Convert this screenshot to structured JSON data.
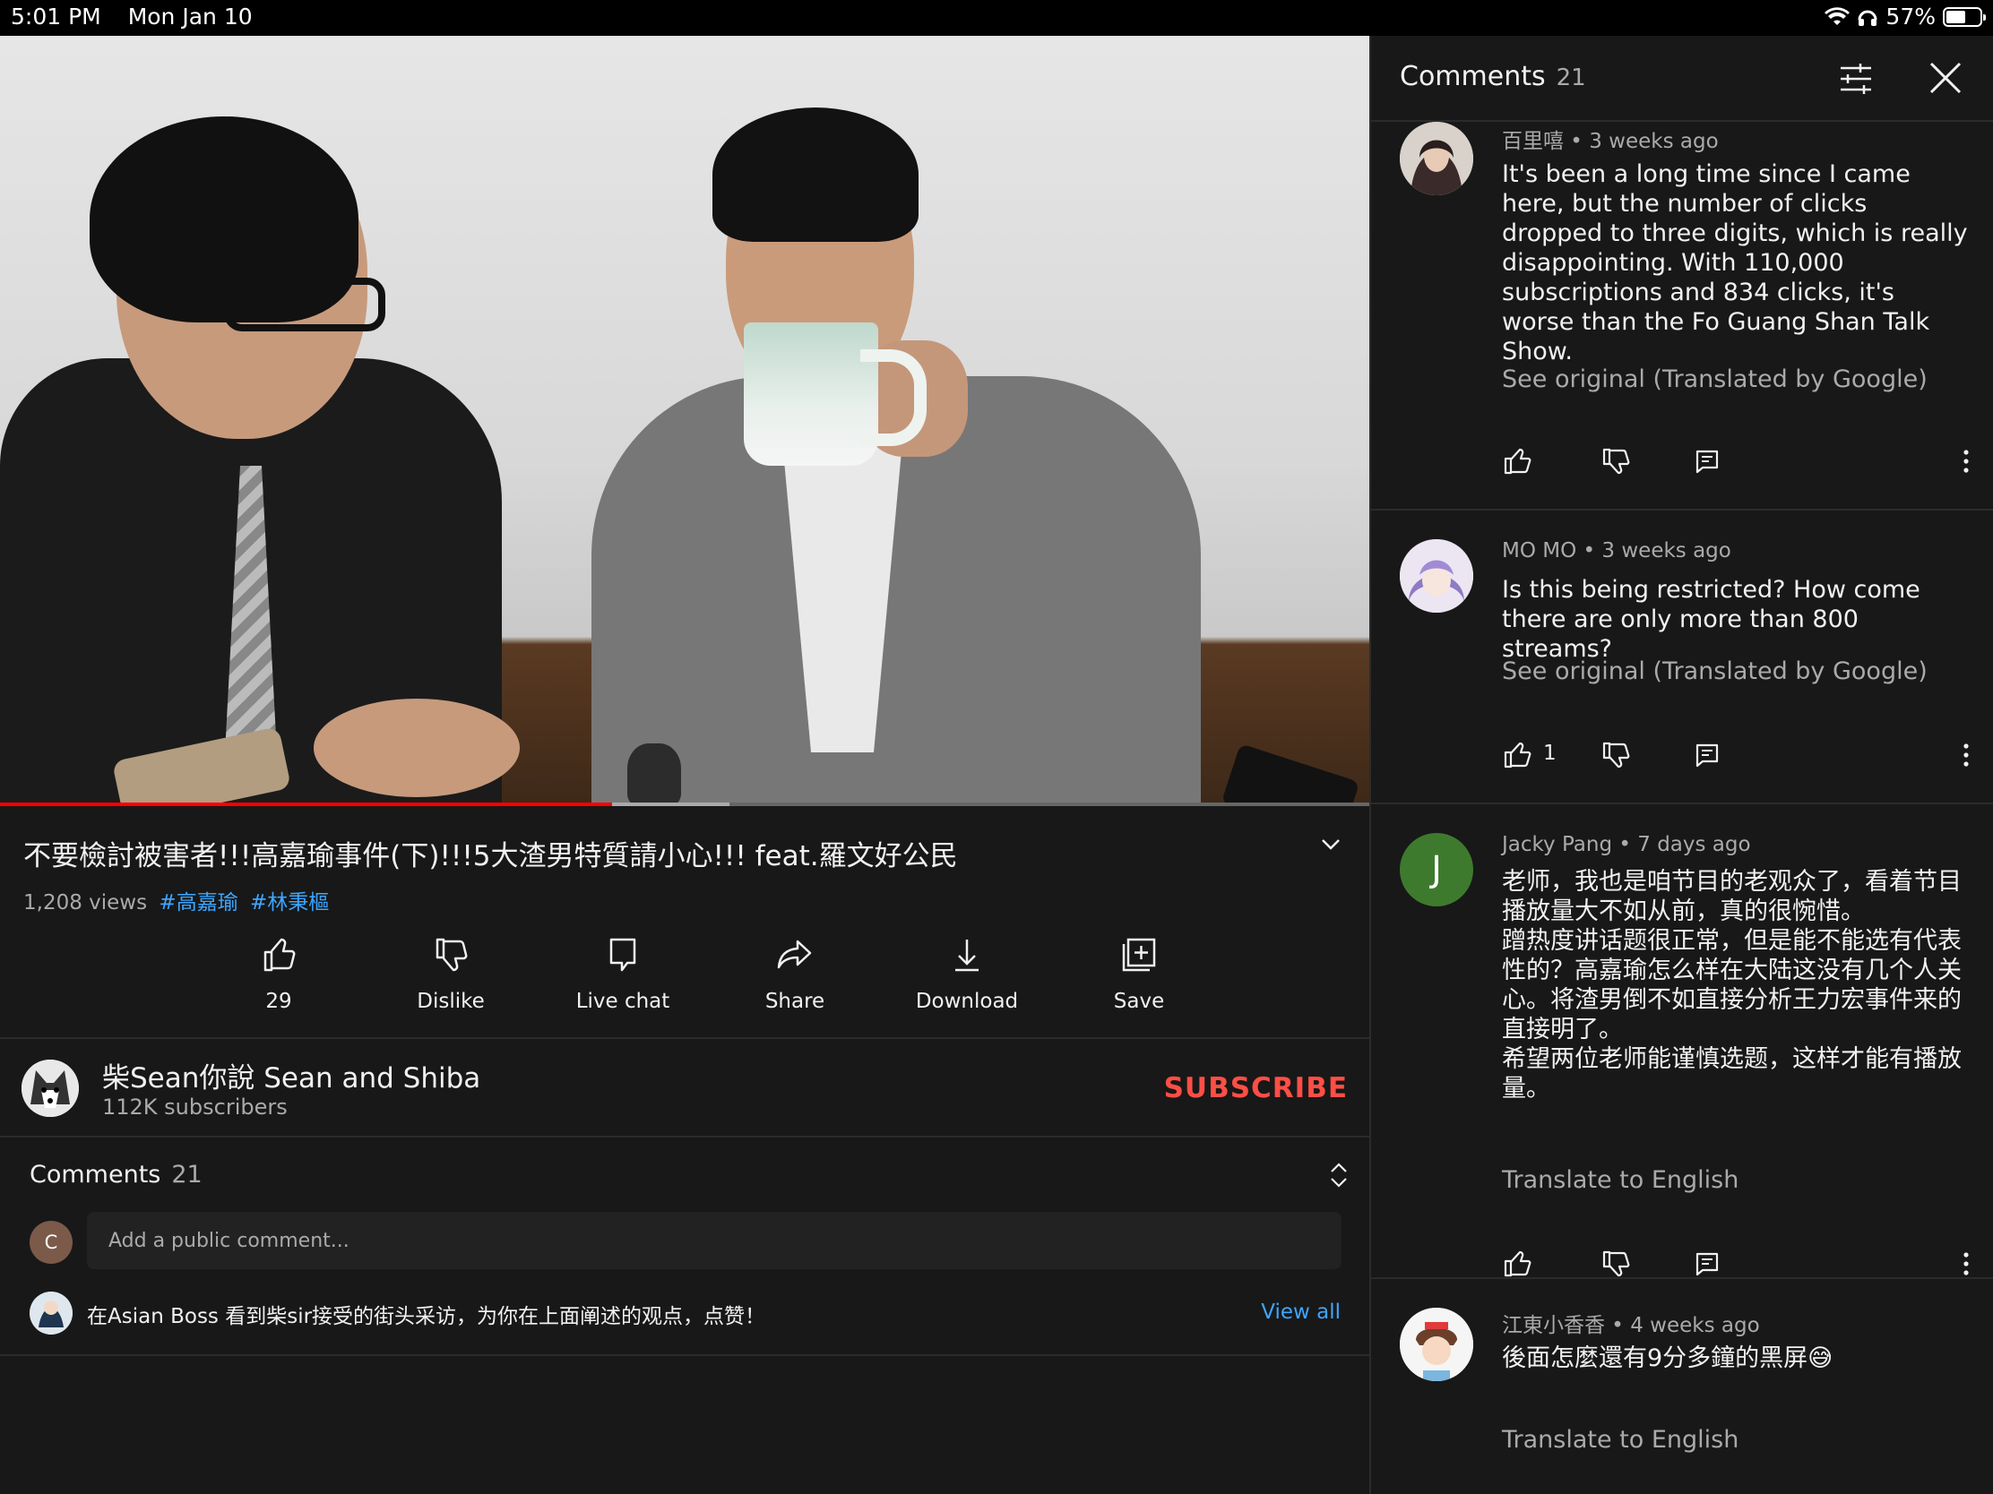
{
  "status_bar": {
    "time": "5:01 PM",
    "date": "Mon Jan 10",
    "battery": "57%",
    "battery_level": 0.57
  },
  "video": {
    "progress_played": 0.447,
    "progress_buffered_end": 0.533,
    "title": "不要檢討被害者!!!高嘉瑜事件(下)!!!5大渣男特質請小心!!! feat.羅文好公民",
    "views": "1,208 views",
    "hashtags": [
      "#高嘉瑜",
      "#林秉樞"
    ]
  },
  "actions": {
    "like": "29",
    "dislike": "Dislike",
    "live_chat": "Live chat",
    "share": "Share",
    "download": "Download",
    "save": "Save"
  },
  "channel": {
    "name": "柴Sean你說 Sean and Shiba",
    "subscribers": "112K subscribers",
    "subscribe_label": "SUBSCRIBE"
  },
  "comments_section": {
    "title": "Comments",
    "count": "21",
    "user_initial": "C",
    "input_placeholder": "Add a public comment...",
    "teaser_text": "在Asian Boss 看到柴sir接受的街头采访，为你在上面阐述的观点，点赞！",
    "view_all": "View all"
  },
  "panel": {
    "title": "Comments",
    "count": "21",
    "comments": [
      {
        "author": "百里嘻",
        "time": "3 weeks ago",
        "text": "It's been a long time since I came here, but the number of clicks dropped to three digits, which is really disappointing. With 110,000 subscriptions and 834 clicks, it's worse than the Fo Guang Shan Talk Show.",
        "translate": "See original (Translated by Google)",
        "likes": ""
      },
      {
        "author": "MO MO",
        "time": "3 weeks ago",
        "text": "Is this being restricted? How come there are only more than 800 streams?",
        "translate": "See original (Translated by Google)",
        "likes": "1"
      },
      {
        "author": "Jacky Pang",
        "avatar_initial": "J",
        "time": "7 days ago",
        "text": "老师，我也是咱节目的老观众了，看着节目播放量大不如从前，真的很惋惜。\n蹭热度讲话题很正常，但是能不能选有代表性的？高嘉瑜怎么样在大陆这没有几个人关心。将渣男倒不如直接分析王力宏事件来的直接明了。\n希望两位老师能谨慎选题，这样才能有播放量。",
        "translate": "Translate to English",
        "likes": ""
      },
      {
        "author": "江東小香香",
        "time": "4 weeks ago",
        "text": "後面怎麼還有9分多鐘的黑屏😅",
        "translate": "Translate to English",
        "likes": ""
      }
    ]
  },
  "colors": {
    "accent_red": "#ff0000",
    "subscribe_red": "#ff4e45",
    "link_blue": "#3ea6ff",
    "background": "#181818"
  }
}
